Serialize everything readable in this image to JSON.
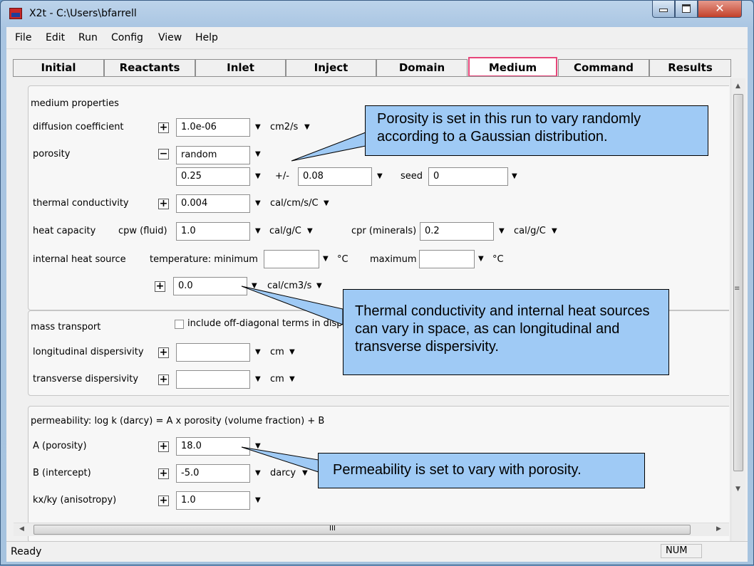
{
  "window": {
    "title": "X2t - C:\\Users\\bfarrell"
  },
  "menu": [
    "File",
    "Edit",
    "Run",
    "Config",
    "View",
    "Help"
  ],
  "tabs": [
    "Initial",
    "Reactants",
    "Inlet",
    "Inject",
    "Domain",
    "Medium",
    "Command",
    "Results"
  ],
  "active_tab": "Medium",
  "medium": {
    "title": "medium properties",
    "diffusion": {
      "label": "diffusion coefficient",
      "value": "1.0e-06",
      "unit": "cm2/s"
    },
    "porosity": {
      "label": "porosity",
      "mode": "random",
      "value": "0.25",
      "pm": "+/-",
      "spread": "0.08",
      "seed_label": "seed",
      "seed": "0"
    },
    "thermal": {
      "label": "thermal conductivity",
      "value": "0.004",
      "unit": "cal/cm/s/C"
    },
    "heat": {
      "label": "heat capacity",
      "cpw_label": "cpw (fluid)",
      "cpw": "1.0",
      "cpw_unit": "cal/g/C",
      "cpr_label": "cpr (minerals)",
      "cpr": "0.2",
      "cpr_unit": "cal/g/C"
    },
    "source": {
      "label": "internal heat source",
      "temp_label": "temperature:  minimum",
      "min": "",
      "min_unit": "°C",
      "max_label": "maximum",
      "max": "",
      "max_unit": "°C",
      "rate": "0.0",
      "rate_unit": "cal/cm3/s"
    }
  },
  "mass": {
    "title": "mass transport",
    "offdiag_label": "include off-diagonal terms in dispe",
    "longitudinal": {
      "label": "longitudinal dispersivity",
      "value": "",
      "unit": "cm"
    },
    "transverse": {
      "label": "transverse dispersivity",
      "value": "",
      "unit": "cm"
    }
  },
  "perm": {
    "title": "permeability: log k (darcy) = A x porosity (volume fraction) + B",
    "a": {
      "label": "A (porosity)",
      "value": "18.0"
    },
    "b": {
      "label": "B (intercept)",
      "value": "-5.0",
      "unit": "darcy"
    },
    "kxky": {
      "label": "kx/ky (anisotropy)",
      "value": "1.0"
    }
  },
  "callouts": {
    "porosity": "Porosity is set in this run to vary randomly according to a Gaussian distribution.",
    "thermal": "Thermal conductivity and internal heat sources can vary in space, as can longitudinal and transverse dispersivity.",
    "perm": "Permeability is set to vary with porosity."
  },
  "status": {
    "text": "Ready",
    "num": "NUM"
  },
  "hscroll_label": "III",
  "colors": {
    "callout_fill": "#9fcaf5",
    "active_tab_border": "#e7467a"
  }
}
